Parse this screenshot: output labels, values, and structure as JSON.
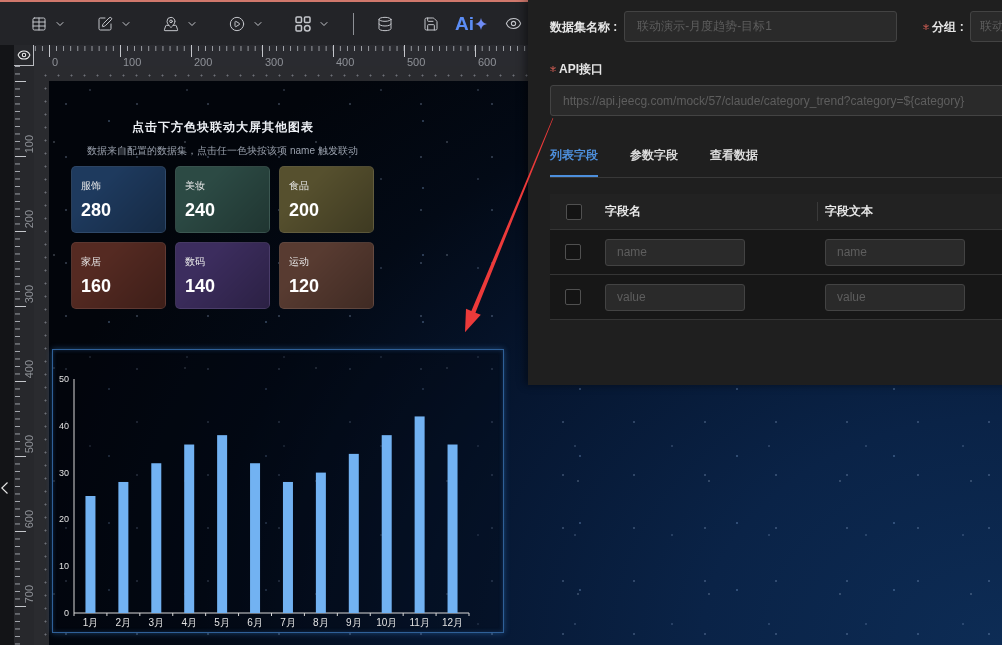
{
  "toolbar": {
    "ai_label": "Ai"
  },
  "rulers": {
    "horizontal": [
      "0",
      "100",
      "200",
      "300",
      "400",
      "500",
      "600"
    ],
    "vertical": [
      "100",
      "200",
      "300",
      "400",
      "500",
      "600",
      "700"
    ]
  },
  "screen": {
    "title": "点击下方色块联动大屏其他图表",
    "subtitle": "数据来自配置的数据集，点击任一色块按该项 name 触发联动",
    "cards": [
      {
        "name": "服饰",
        "value": "280",
        "color": "#1e3a5e"
      },
      {
        "name": "美妆",
        "value": "240",
        "color": "#2c4a44"
      },
      {
        "name": "食品",
        "value": "200",
        "color": "#56502e"
      },
      {
        "name": "家居",
        "value": "160",
        "color": "#552a22"
      },
      {
        "name": "数码",
        "value": "140",
        "color": "#3c2d5e"
      },
      {
        "name": "运动",
        "value": "120",
        "color": "#583b31"
      }
    ],
    "chart": {
      "chart_data": {
        "type": "bar",
        "categories": [
          "1月",
          "2月",
          "3月",
          "4月",
          "5月",
          "6月",
          "7月",
          "8月",
          "9月",
          "10月",
          "11月",
          "12月"
        ],
        "series": [
          {
            "color": "#72b2f2",
            "values": [
              25,
              28,
              32,
              36,
              38,
              32,
              28,
              30,
              34,
              38,
              42,
              36
            ]
          }
        ],
        "ylim": [
          0,
          50
        ],
        "yticks": [
          0,
          10,
          20,
          30,
          40,
          50
        ]
      }
    }
  },
  "dataset_panel": {
    "name_field": {
      "label": "数据集名称 :",
      "required": false,
      "value": "联动演示-月度趋势-目标1",
      "disabled": true
    },
    "group_field": {
      "label": "分组 :",
      "required": true,
      "value": "联动",
      "disabled": true
    },
    "api_field": {
      "label": "API接口",
      "required": true,
      "value": "https://api.jeecg.com/mock/57/claude/category_trend?category=${category}",
      "disabled": true
    },
    "tabs": [
      {
        "label": "列表字段",
        "selected": true
      },
      {
        "label": "参数字段",
        "selected": false
      },
      {
        "label": "查看数据",
        "selected": false
      }
    ],
    "table": {
      "columns": [
        "字段名",
        "字段文本"
      ],
      "select_all": {
        "checked": false
      },
      "rows": [
        {
          "checked": false,
          "cells": [
            {
              "value": "name",
              "disabled": true
            },
            {
              "value": "name",
              "disabled": true
            }
          ]
        },
        {
          "checked": false,
          "cells": [
            {
              "value": "value",
              "disabled": true
            },
            {
              "value": "value",
              "disabled": true
            }
          ]
        }
      ]
    }
  },
  "annotations": [
    {
      "kind": "arrow"
    }
  ]
}
